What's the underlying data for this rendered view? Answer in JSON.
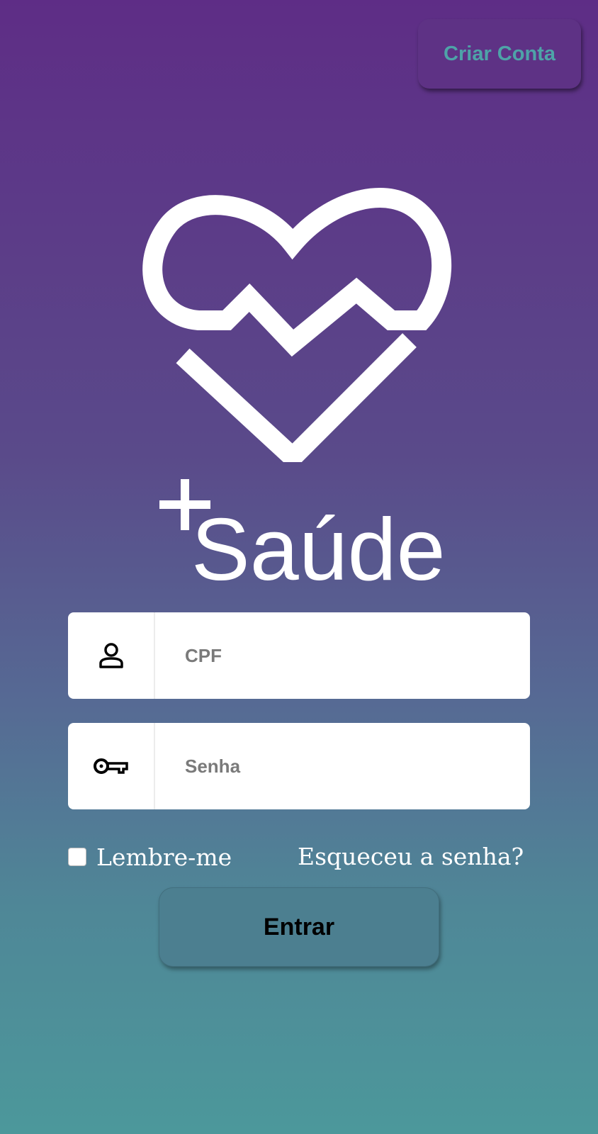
{
  "header": {
    "create_account_label": "Criar Conta"
  },
  "logo": {
    "icon": "heart-pulse-icon",
    "plus": "+",
    "name": "Saúde"
  },
  "form": {
    "cpf": {
      "icon": "person-icon",
      "placeholder": "CPF",
      "value": ""
    },
    "password": {
      "icon": "key-icon",
      "placeholder": "Senha",
      "value": ""
    },
    "remember_me_label": "Lembre-me",
    "remember_me_checked": false,
    "forgot_password_label": "Esqueceu a senha?",
    "submit_label": "Entrar"
  },
  "colors": {
    "gradient_top": "#5e2d86",
    "gradient_bottom": "#4c989b",
    "accent_text": "#4ea3a8",
    "logo": "#ffffff"
  }
}
